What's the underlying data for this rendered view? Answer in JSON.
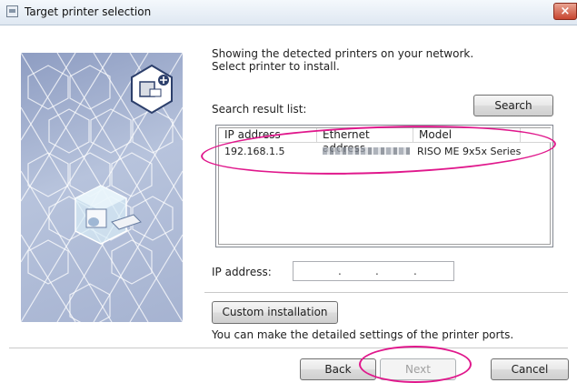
{
  "window": {
    "title": "Target printer selection",
    "close_label": "×"
  },
  "instructions": {
    "line1": "Showing the detected printers on your network.",
    "line2": "Select printer to install."
  },
  "search": {
    "list_label": "Search result list:",
    "button_label": "Search"
  },
  "results_table": {
    "columns": [
      "IP address",
      "Ethernet address",
      "Model"
    ],
    "rows": [
      {
        "ip": "192.168.1.5",
        "ethernet": "",
        "model": "RISO ME 9x5x Series"
      }
    ]
  },
  "ip_entry": {
    "label": "IP address:",
    "separator": "."
  },
  "custom": {
    "button_label": "Custom installation",
    "note": "You can make the detailed settings of the printer ports."
  },
  "footer": {
    "back_label": "Back",
    "next_label": "Next",
    "next_enabled": false,
    "cancel_label": "Cancel"
  },
  "colors": {
    "highlight": "#e0188c",
    "panel": "#a6b3d1"
  },
  "icons": [
    "window-icon",
    "close-icon",
    "printer-add-icon",
    "printer-cube-illustration"
  ]
}
